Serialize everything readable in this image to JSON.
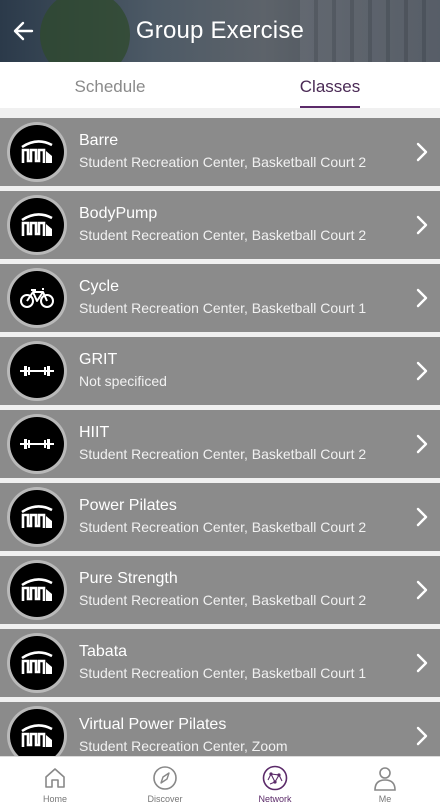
{
  "header": {
    "title": "Group Exercise",
    "back_icon": "arrow-left-icon"
  },
  "tabs": [
    {
      "label": "Schedule",
      "active": false
    },
    {
      "label": "Classes",
      "active": true
    }
  ],
  "classes": [
    {
      "name": "Barre",
      "location": "Student Recreation Center, Basketball Court 2",
      "icon": "logo-m-icon"
    },
    {
      "name": "BodyPump",
      "location": "Student Recreation Center, Basketball Court 2",
      "icon": "logo-m-icon"
    },
    {
      "name": "Cycle",
      "location": "Student Recreation Center, Basketball Court 1",
      "icon": "bicycle-icon"
    },
    {
      "name": "GRIT",
      "location": "Not specificed",
      "icon": "barbell-icon"
    },
    {
      "name": "HIIT",
      "location": "Student Recreation Center, Basketball Court 2",
      "icon": "barbell-icon"
    },
    {
      "name": "Power Pilates",
      "location": "Student Recreation Center, Basketball Court 2",
      "icon": "logo-m-icon"
    },
    {
      "name": "Pure Strength",
      "location": "Student Recreation Center, Basketball Court 2",
      "icon": "logo-m-icon"
    },
    {
      "name": "Tabata",
      "location": "Student Recreation Center, Basketball Court 1",
      "icon": "logo-m-icon"
    },
    {
      "name": "Virtual Power Pilates",
      "location": "Student Recreation Center, Zoom",
      "icon": "logo-m-icon"
    }
  ],
  "bottom_nav": [
    {
      "label": "Home",
      "icon": "home-icon",
      "active": false
    },
    {
      "label": "Discover",
      "icon": "compass-icon",
      "active": false
    },
    {
      "label": "Network",
      "icon": "network-icon",
      "active": true
    },
    {
      "label": "Me",
      "icon": "person-icon",
      "active": false
    }
  ],
  "colors": {
    "accent": "#5b2a69",
    "row_bg": "#8b8b8b",
    "list_bg": "#f0f0f0"
  }
}
